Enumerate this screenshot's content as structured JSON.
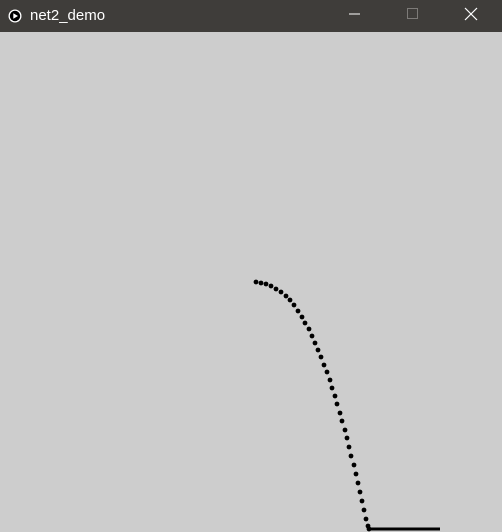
{
  "window": {
    "title": "net2_demo",
    "titlebar_color": "#3f3d3a",
    "background_color": "#cdcdcd",
    "icons": {
      "app": "processing-play-icon",
      "minimize": "minimize-icon",
      "maximize": "maximize-icon",
      "close": "close-icon"
    }
  },
  "sketch": {
    "dot_color": "#000000",
    "dot_count": 40
  }
}
